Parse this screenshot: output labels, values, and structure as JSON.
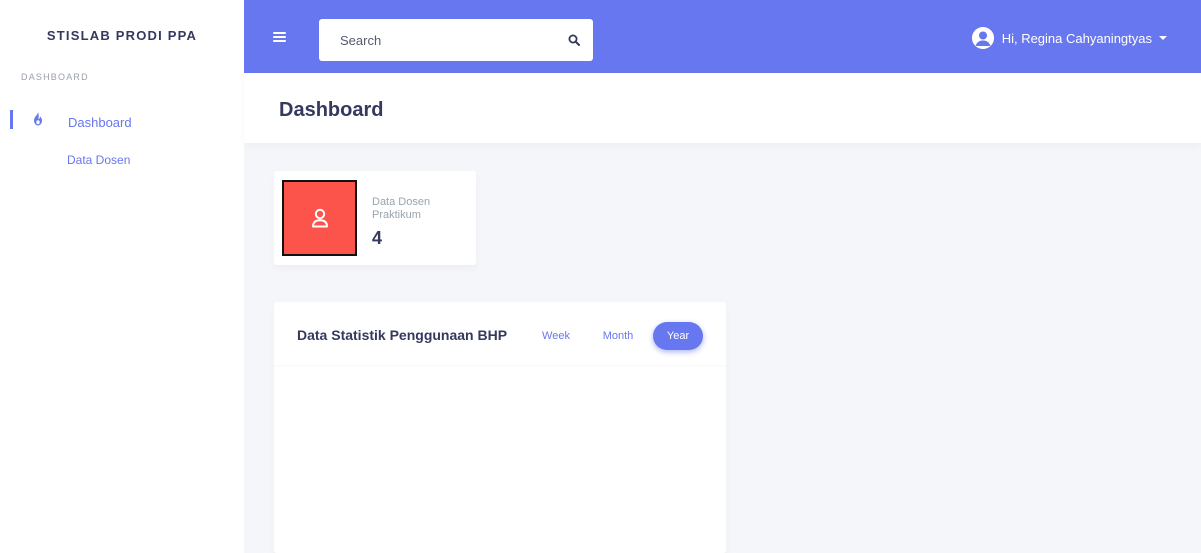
{
  "sidebar": {
    "brand": "STISLAB PRODI PPA",
    "menu_header": "DASHBOARD",
    "items": [
      {
        "label": "Dashboard",
        "icon": "fire-icon",
        "active": true
      },
      {
        "label": "Data Dosen"
      }
    ]
  },
  "navbar": {
    "search": {
      "placeholder": "Search",
      "value": ""
    },
    "user": {
      "greeting": "Hi, Regina Cahyaningtyas"
    }
  },
  "section": {
    "title": "Dashboard"
  },
  "stat_card": {
    "label": "Data Dosen Praktikum",
    "value": "4",
    "icon": "user-icon"
  },
  "chart_card": {
    "title": "Data Statistik Penggunaan BHP",
    "periods": [
      "Week",
      "Month",
      "Year"
    ],
    "selected": "Year"
  },
  "colors": {
    "primary": "#6777ef",
    "danger": "#fc544b",
    "text": "#34395e",
    "muted": "#98a6ad",
    "background": "#f4f6f9"
  }
}
